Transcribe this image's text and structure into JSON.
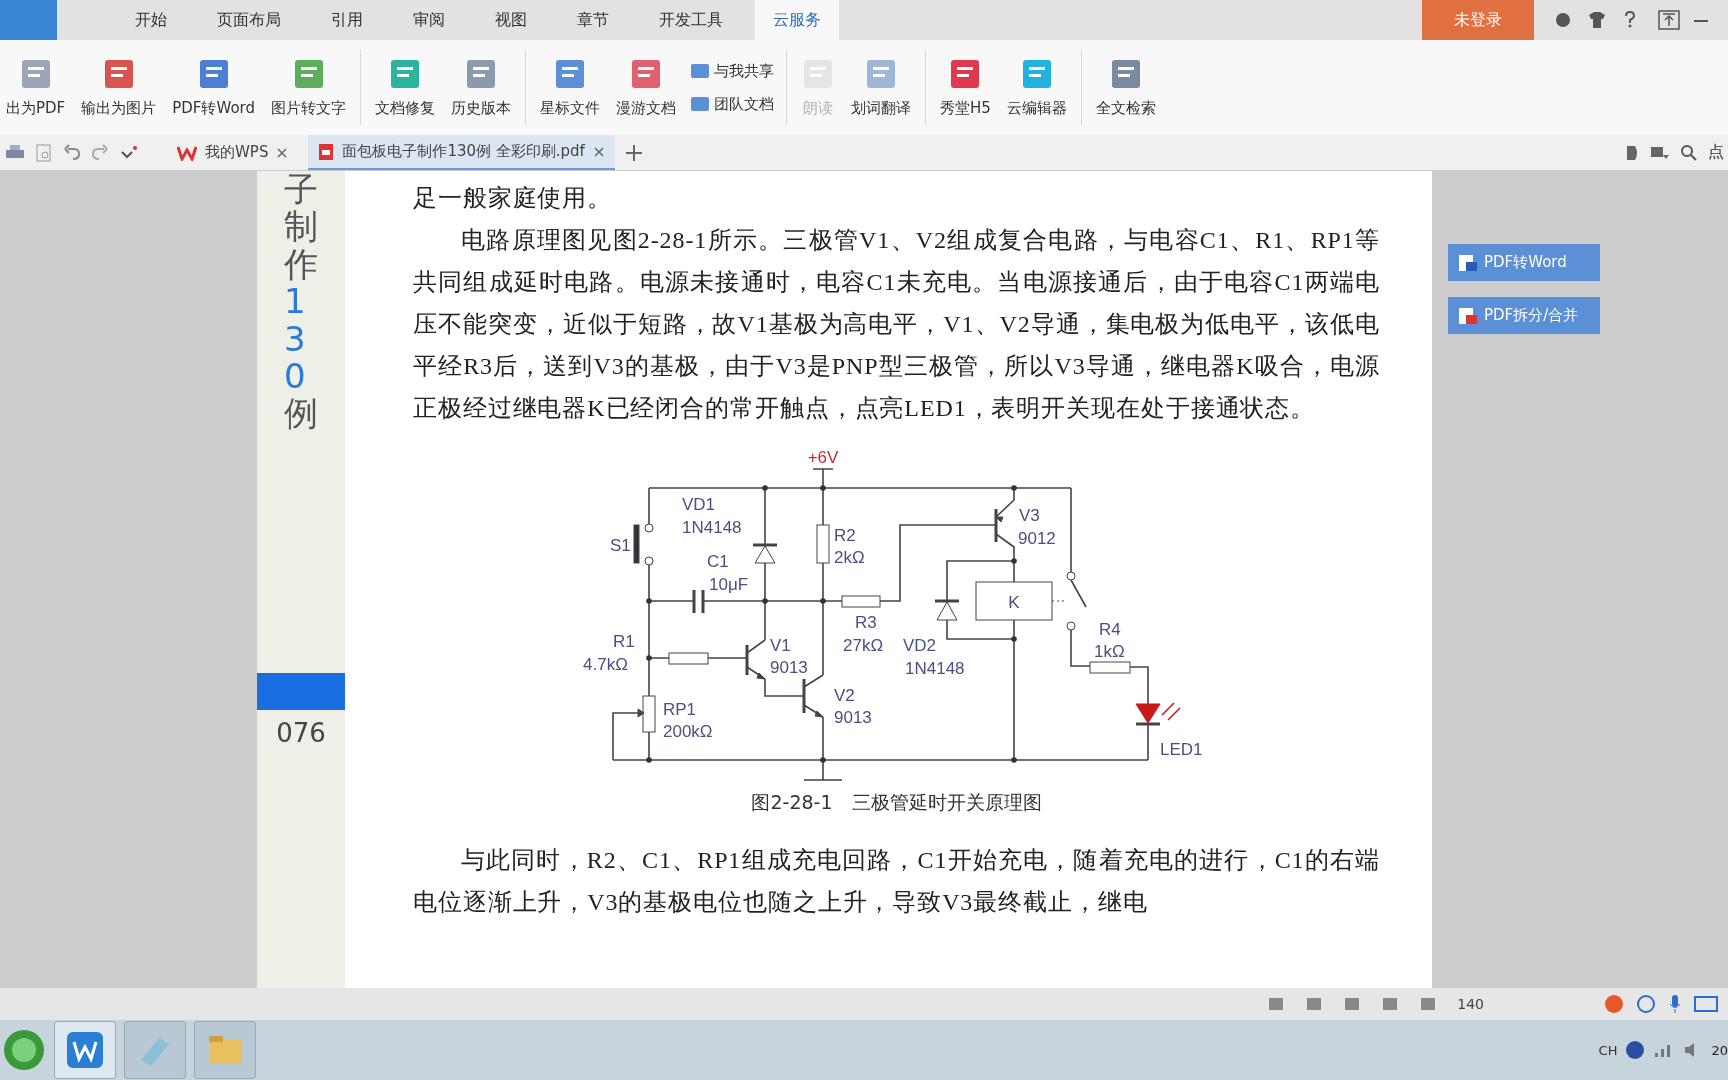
{
  "menu_tabs": [
    {
      "label": "开始",
      "selected": false
    },
    {
      "label": "页面布局",
      "selected": false
    },
    {
      "label": "引用",
      "selected": false
    },
    {
      "label": "审阅",
      "selected": false
    },
    {
      "label": "视图",
      "selected": false
    },
    {
      "label": "章节",
      "selected": false
    },
    {
      "label": "开发工具",
      "selected": false
    },
    {
      "label": "云服务",
      "selected": true
    }
  ],
  "login_button": "未登录",
  "toolbar": [
    {
      "kind": "large",
      "label": "出为PDF",
      "disabled": false
    },
    {
      "kind": "large",
      "label": "输出为图片",
      "disabled": false
    },
    {
      "kind": "large",
      "label": "PDF转Word",
      "disabled": false
    },
    {
      "kind": "large",
      "label": "图片转文字",
      "disabled": false
    },
    {
      "kind": "separator"
    },
    {
      "kind": "large",
      "label": "文档修复",
      "disabled": false
    },
    {
      "kind": "large",
      "label": "历史版本",
      "disabled": false
    },
    {
      "kind": "separator"
    },
    {
      "kind": "large",
      "label": "星标文件",
      "disabled": false
    },
    {
      "kind": "large",
      "label": "漫游文档",
      "disabled": false
    },
    {
      "kind": "pair",
      "items": [
        {
          "label": "与我共享"
        },
        {
          "label": "团队文档"
        }
      ]
    },
    {
      "kind": "separator"
    },
    {
      "kind": "large",
      "label": "朗读",
      "disabled": true
    },
    {
      "kind": "large",
      "label": "划词翻译",
      "disabled": false
    },
    {
      "kind": "separator"
    },
    {
      "kind": "large",
      "label": "秀堂H5",
      "disabled": false
    },
    {
      "kind": "large",
      "label": "云编辑器",
      "disabled": false
    },
    {
      "kind": "separator"
    },
    {
      "kind": "large",
      "label": "全文检索",
      "disabled": false
    }
  ],
  "doc_tabs": [
    {
      "label": "我的WPS",
      "selected": false
    },
    {
      "label": "面包板电子制作130例  全彩印刷.pdf",
      "selected": true
    }
  ],
  "search_hint": "点",
  "page": {
    "side_title": [
      {
        "text": "子制作",
        "kind": "plain"
      },
      {
        "text": "130",
        "kind": "accent"
      },
      {
        "text": "例",
        "kind": "plain"
      }
    ],
    "page_number": "076",
    "paragraphs": [
      {
        "text": "足一般家庭使用。",
        "kind": "continuation"
      },
      {
        "text": "电路原理图见图2-28-1所示。三极管V1、V2组成复合电路，与电容C1、R1、RP1等共同组成延时电路。电源未接通时，电容C1未充电。当电源接通后，由于电容C1两端电压不能突变，近似于短路，故V1基极为高电平，V1、V2导通，集电极为低电平，该低电平经R3后，送到V3的基极，由于V3是PNP型三极管，所以V3导通，继电器K吸合，电源正极经过继电器K已经闭合的常开触点，点亮LED1，表明开关现在处于接通状态。",
        "kind": "paragraph"
      }
    ],
    "figure": {
      "labels": [
        {
          "text": "+6V",
          "kind": "supply"
        },
        {
          "text": "VD1",
          "kind": "part"
        },
        {
          "text": "1N4148",
          "kind": "part"
        },
        {
          "text": "S1",
          "kind": "part"
        },
        {
          "text": "C1",
          "kind": "part"
        },
        {
          "text": "10μF",
          "kind": "part"
        },
        {
          "text": "R2",
          "kind": "part"
        },
        {
          "text": "2kΩ",
          "kind": "part"
        },
        {
          "text": "V3",
          "kind": "part"
        },
        {
          "text": "9012",
          "kind": "part"
        },
        {
          "text": "K",
          "kind": "part"
        },
        {
          "text": "R3",
          "kind": "part"
        },
        {
          "text": "27kΩ",
          "kind": "part"
        },
        {
          "text": "VD2",
          "kind": "part"
        },
        {
          "text": "1N4148",
          "kind": "part"
        },
        {
          "text": "R1",
          "kind": "part"
        },
        {
          "text": "4.7kΩ",
          "kind": "part"
        },
        {
          "text": "V1",
          "kind": "part"
        },
        {
          "text": "9013",
          "kind": "part"
        },
        {
          "text": "V2",
          "kind": "part"
        },
        {
          "text": "9013",
          "kind": "part"
        },
        {
          "text": "RP1",
          "kind": "part"
        },
        {
          "text": "200kΩ",
          "kind": "part"
        },
        {
          "text": "R4",
          "kind": "part"
        },
        {
          "text": "1kΩ",
          "kind": "part"
        },
        {
          "text": "LED1",
          "kind": "part"
        }
      ],
      "caption": "图2-28-1　三极管延时开关原理图"
    },
    "after": [
      {
        "text": "与此同时，R2、C1、RP1组成充电回路，C1开始充电，随着充电的进行，C1的右端电位逐渐上升，V3的基极电位也随之上升，导致V3最终截止，继电",
        "kind": "paragraph"
      }
    ]
  },
  "side_buttons": [
    {
      "label": "PDF转Word"
    },
    {
      "label": "PDF拆分/合并"
    }
  ],
  "status": {
    "zoom": "140"
  },
  "tray": {
    "lang": "CH",
    "clock": "20"
  }
}
